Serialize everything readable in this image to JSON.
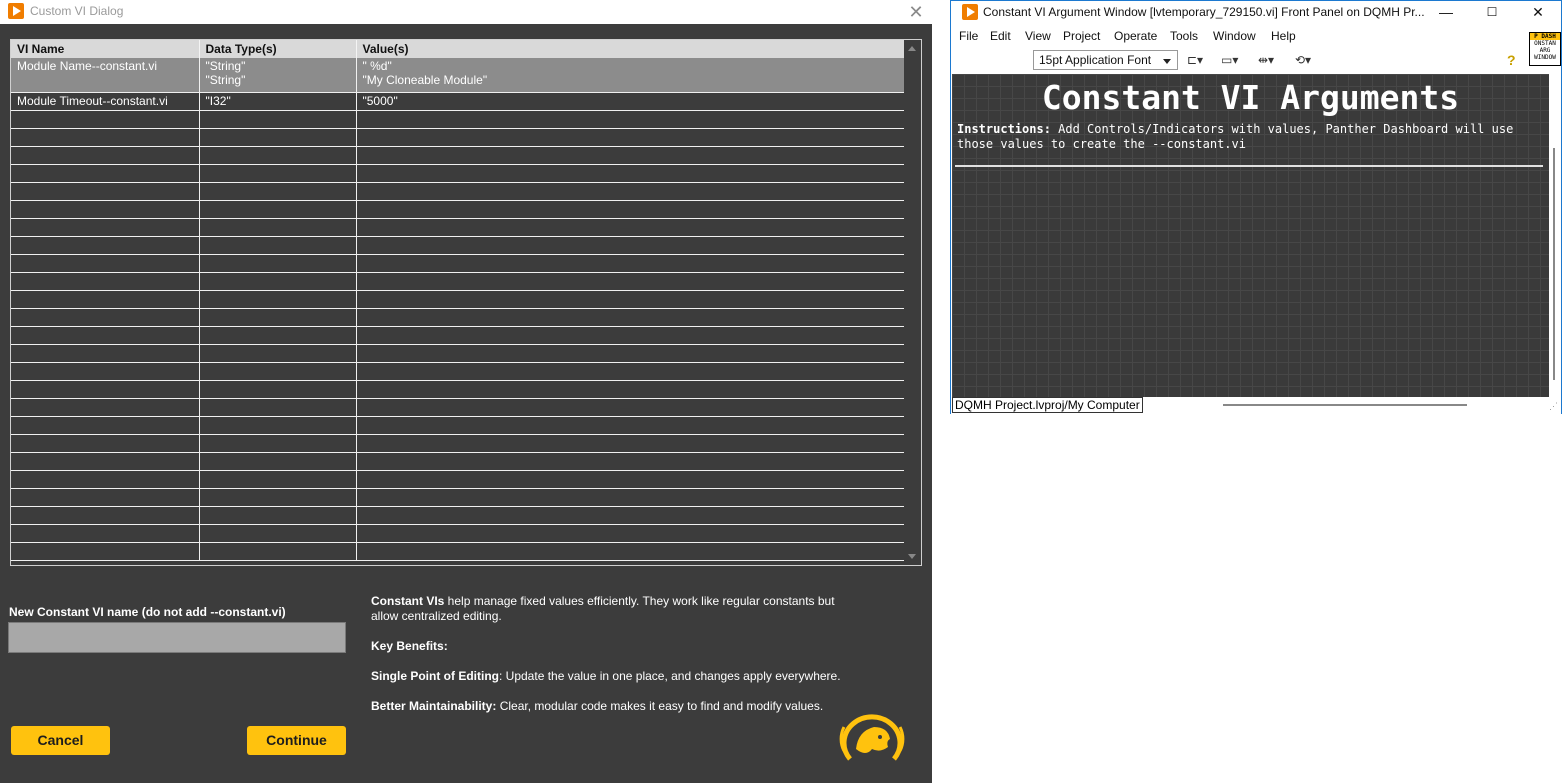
{
  "dialog": {
    "title": "Custom VI Dialog",
    "close_glyph": "✕",
    "table": {
      "columns": [
        "VI Name",
        "Data Type(s)",
        "Value(s)"
      ],
      "rows": [
        {
          "vi_name": "Module Name--constant.vi",
          "types": "\"String\"\n\"String\"",
          "values": "\" %d\"\n\"My Cloneable Module\"",
          "selected": true
        },
        {
          "vi_name": "Module Timeout--constant.vi",
          "types": "\"I32\"",
          "values": "\"5000\"",
          "selected": false
        }
      ]
    },
    "new_name_label": "New Constant VI name (do not add --constant.vi)",
    "new_name_value": "",
    "info": {
      "p1_bold": "Constant VIs",
      "p1_text": " help manage fixed values efficiently. They work like regular constants but allow centralized editing.",
      "p2_bold": "Key Benefits:",
      "p3_bold": "Single Point of Editing",
      "p3_text": ": Update the value in one place, and changes apply everywhere.",
      "p4_bold": "Better Maintainability:",
      "p4_text": " Clear, modular code makes it easy to find and modify values."
    },
    "cancel_label": "Cancel",
    "continue_label": "Continue",
    "accent": "#ffc20e"
  },
  "lv_window": {
    "title": "Constant VI Argument Window [lvtemporary_729150.vi] Front Panel on DQMH Pr...",
    "controls": {
      "minimize": "—",
      "maximize": "☐",
      "close": "✕"
    },
    "menu": [
      "File",
      "Edit",
      "View",
      "Project",
      "Operate",
      "Tools",
      "Window",
      "Help"
    ],
    "font_select": "15pt Application Font",
    "toolbar_icons": [
      "align-objects-icon",
      "distribute-objects-icon",
      "resize-objects-icon",
      "reorder-icon"
    ],
    "help_glyph": "?",
    "vi_icon_lines": [
      "P DASH",
      "ONSTAN",
      "ARG",
      "WINDOW"
    ],
    "panel": {
      "heading": "Constant VI Arguments",
      "instructions_bold": "Instructions:",
      "instructions_text": " Add Controls/Indicators with values, Panther Dashboard will use those values to create the --constant.vi"
    },
    "status_path": "DQMH Project.lvproj/My Computer"
  }
}
